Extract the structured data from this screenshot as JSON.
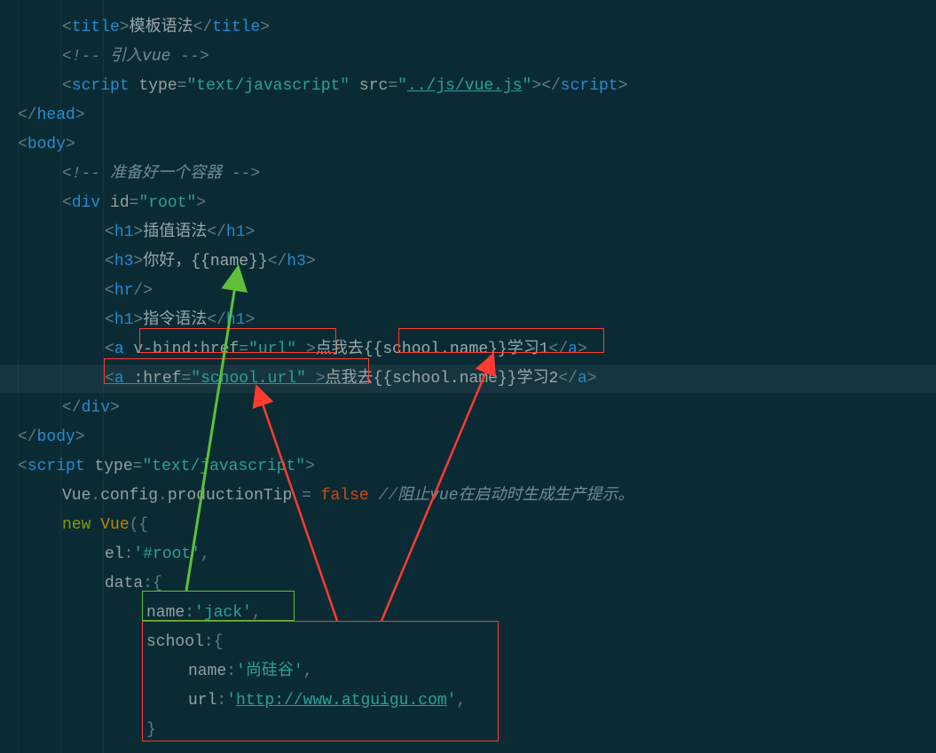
{
  "lines": {
    "l1": {
      "title_open": "<title>",
      "title_text": "模板语法",
      "title_close": "</title>"
    },
    "l2": {
      "cmt_open": "<!-- ",
      "cmt_text": "引入vue",
      "cmt_close": " -->"
    },
    "l3": {
      "open": "<script ",
      "attr1": "type",
      "eq": "=",
      "val1": "\"text/javascript\"",
      "sp": " ",
      "attr2": "src",
      "val2_open": "\"",
      "val2": "../js/vue.js",
      "val2_close": "\"",
      "gt": ">",
      "close": "</script>"
    },
    "l4": {
      "txt": "</head>"
    },
    "l5": {
      "txt": "<body>"
    },
    "l6": {
      "cmt_open": "<!-- ",
      "cmt_text": "准备好一个容器",
      "cmt_close": " -->"
    },
    "l7": {
      "open": "<div ",
      "attr": "id",
      "val": "\"root\"",
      "gt": ">"
    },
    "l8": {
      "open": "<h1>",
      "text": "插值语法",
      "close": "</h1>"
    },
    "l9": {
      "open": "<h3>",
      "text": "你好，{{name}}",
      "close": "</h3>"
    },
    "l10": {
      "txt": "<hr/>"
    },
    "l11": {
      "open": "<h1>",
      "text": "指令语法",
      "close": "</h1>"
    },
    "l12": {
      "open": "<a ",
      "attr": "v-bind:href",
      "val": "\"url\"",
      "sp": " ",
      "gt": ">",
      "text": "点我去{{school.name}}学习1",
      "close": "</a>"
    },
    "l13": {
      "open": "<a ",
      "attr": ":href",
      "val": "\"school.url\"",
      "sp": " ",
      "gt": ">",
      "text": "点我去{{school.name}}学习2",
      "close": "</a>"
    },
    "l14": {
      "txt": "</div>"
    },
    "l15": {
      "txt": "</body>"
    },
    "l16": {
      "open": "<script ",
      "attr": "type",
      "val": "\"text/javascript\"",
      "gt": ">"
    },
    "l17": {
      "p1": "Vue",
      "dot1": ".",
      "p2": "config",
      "dot2": ".",
      "p3": "productionTip",
      "eq": " = ",
      "val": "false",
      "sp": " ",
      "cmt": "//",
      "cmttext": "阻止vue在启动时生成生产提示。"
    },
    "l18": {
      "kw": "new ",
      "cls": "Vue",
      "open": "({"
    },
    "l19": {
      "key": "el",
      "colon": ":",
      "val": "'#root'",
      "comma": ","
    },
    "l20": {
      "key": "data",
      "colon": ":",
      "open": "{"
    },
    "l21": {
      "key": "name",
      "colon": ":",
      "val": "'jack'",
      "comma": ","
    },
    "l22": {
      "key": "school",
      "colon": ":",
      "open": "{"
    },
    "l23": {
      "key": "name",
      "colon": ":",
      "val": "'尚硅谷'",
      "comma": ","
    },
    "l24": {
      "key": "url",
      "colon": ":",
      "q": "'",
      "val": "http://www.atguigu.com",
      "q2": "'",
      "comma": ","
    },
    "l25": {
      "close": "}"
    }
  }
}
